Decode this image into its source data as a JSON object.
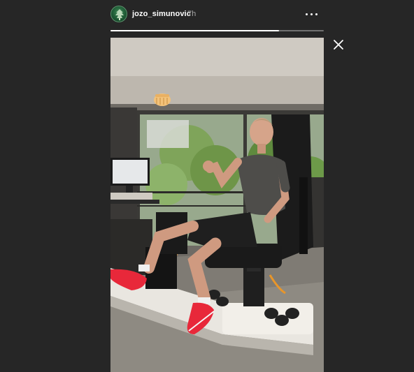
{
  "story": {
    "username": "jozo_simunovic",
    "time_ago": "7h",
    "progress": 0.79
  },
  "icons": {
    "avatar": "club-crest-avatar",
    "more": "more-options-icon",
    "close": "close-icon",
    "sticker": "fist-bump-emoji"
  },
  "colors": {
    "background": "#262626",
    "text": "#ffffff",
    "muted_text": "#a8a8a8",
    "sneaker": "#e8283a"
  }
}
